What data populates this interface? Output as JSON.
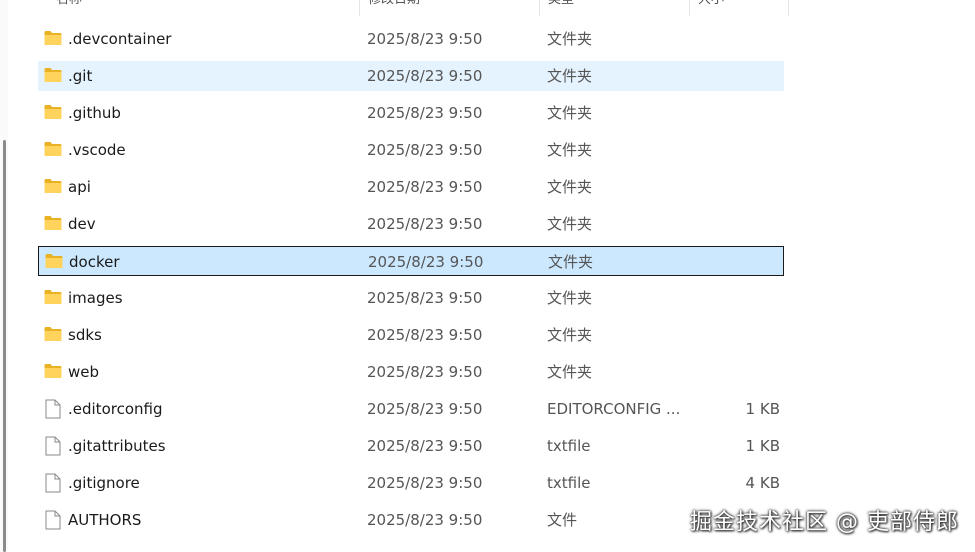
{
  "header": {
    "name": "名称",
    "date": "修改日期",
    "type": "类型",
    "size": "大小"
  },
  "rows": [
    {
      "name": ".devcontainer",
      "date": "2025/8/23 9:50",
      "type": "文件夹",
      "size": "",
      "icon": "folder-icon"
    },
    {
      "name": ".git",
      "date": "2025/8/23 9:50",
      "type": "文件夹",
      "size": "",
      "icon": "folder-icon"
    },
    {
      "name": ".github",
      "date": "2025/8/23 9:50",
      "type": "文件夹",
      "size": "",
      "icon": "folder-icon"
    },
    {
      "name": ".vscode",
      "date": "2025/8/23 9:50",
      "type": "文件夹",
      "size": "",
      "icon": "folder-icon"
    },
    {
      "name": "api",
      "date": "2025/8/23 9:50",
      "type": "文件夹",
      "size": "",
      "icon": "folder-icon"
    },
    {
      "name": "dev",
      "date": "2025/8/23 9:50",
      "type": "文件夹",
      "size": "",
      "icon": "folder-icon"
    },
    {
      "name": "docker",
      "date": "2025/8/23 9:50",
      "type": "文件夹",
      "size": "",
      "icon": "folder-icon"
    },
    {
      "name": "images",
      "date": "2025/8/23 9:50",
      "type": "文件夹",
      "size": "",
      "icon": "folder-icon"
    },
    {
      "name": "sdks",
      "date": "2025/8/23 9:50",
      "type": "文件夹",
      "size": "",
      "icon": "folder-icon"
    },
    {
      "name": "web",
      "date": "2025/8/23 9:50",
      "type": "文件夹",
      "size": "",
      "icon": "folder-icon"
    },
    {
      "name": ".editorconfig",
      "date": "2025/8/23 9:50",
      "type": "EDITORCONFIG ...",
      "size": "1 KB",
      "icon": "file-icon"
    },
    {
      "name": ".gitattributes",
      "date": "2025/8/23 9:50",
      "type": "txtfile",
      "size": "1 KB",
      "icon": "file-icon"
    },
    {
      "name": ".gitignore",
      "date": "2025/8/23 9:50",
      "type": "txtfile",
      "size": "4 KB",
      "icon": "file-icon"
    },
    {
      "name": "AUTHORS",
      "date": "2025/8/23 9:50",
      "type": "文件",
      "size": "",
      "icon": "file-icon"
    }
  ],
  "states": {
    "hover_index": 1,
    "selected_index": 6
  },
  "watermark": "掘金技术社区 @ 吏部侍郎",
  "colors": {
    "folder": "#f4c430",
    "hover": "#e5f3ff",
    "selected": "#cce8ff"
  }
}
